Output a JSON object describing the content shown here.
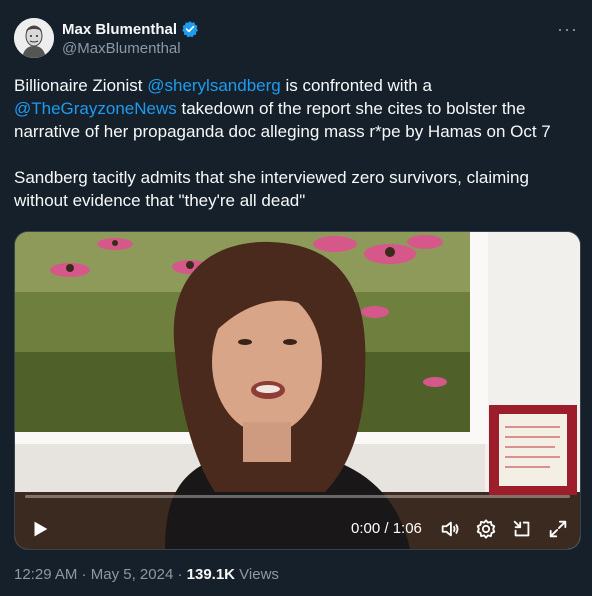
{
  "author": {
    "display_name": "Max Blumenthal",
    "handle": "@MaxBlumenthal",
    "verified": true
  },
  "tweet": {
    "para1_part1": "Billionaire Zionist ",
    "mention1": "@sherylsandberg",
    "para1_part2": " is confronted with a ",
    "mention2": "@TheGrayzoneNews",
    "para1_part3": " takedown of the report she cites to bolster the narrative of her propaganda doc alleging mass r*pe by Hamas on Oct 7",
    "para2": "Sandberg tacitly admits that she interviewed zero survivors, claiming without evidence that \"they're all dead\""
  },
  "video": {
    "time": "0:00 / 1:06",
    "progress": 0.0,
    "icons": [
      "play-icon",
      "volume-icon",
      "settings-icon",
      "minimize-icon",
      "fullscreen-icon"
    ]
  },
  "footer": {
    "time": "12:29 AM",
    "sep1": " · ",
    "date": "May 5, 2024",
    "sep2": " · ",
    "views": "139.1K",
    "views_label": " Views"
  },
  "colors": {
    "background": "#15202b",
    "link": "#1d9bf0",
    "secondary_text": "#8b98a5",
    "verified": "#1d9bf0"
  }
}
